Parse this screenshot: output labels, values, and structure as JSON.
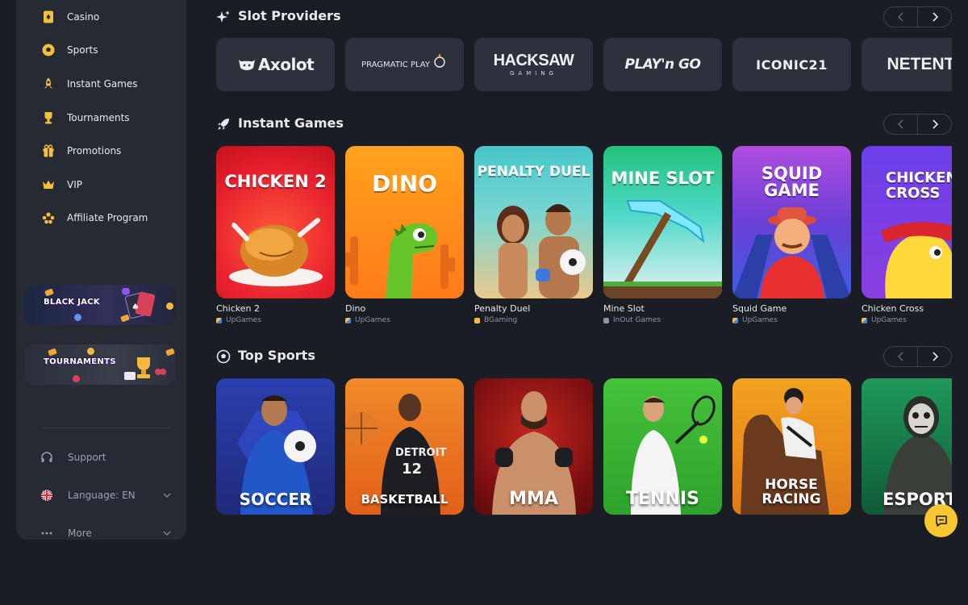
{
  "sidebar": {
    "items": [
      {
        "label": "Casino",
        "icon": "cards-icon"
      },
      {
        "label": "Sports",
        "icon": "soccer-ball-icon"
      },
      {
        "label": "Instant Games",
        "icon": "rocket-icon"
      },
      {
        "label": "Tournaments",
        "icon": "trophy-icon"
      },
      {
        "label": "Promotions",
        "icon": "gift-icon"
      },
      {
        "label": "VIP",
        "icon": "crown-icon"
      },
      {
        "label": "Affiliate Program",
        "icon": "group-icon"
      }
    ],
    "banners": {
      "blackjack": "BLACK JACK",
      "tournaments": "TOURNAMENTS"
    },
    "footer": {
      "support": "Support",
      "language": "Language: EN",
      "more": "More"
    }
  },
  "sections": {
    "slot_providers": {
      "title": "Slot Providers",
      "providers": [
        "Axolot",
        "PRAGMATIC PLAY",
        "HACKSAW",
        "GAMING",
        "PLAY'n GO",
        "ICONIC21",
        "NETENT"
      ]
    },
    "instant_games": {
      "title": "Instant Games",
      "games": [
        {
          "thumb_title": "CHICKEN 2",
          "name": "Chicken 2",
          "provider": "UpGames"
        },
        {
          "thumb_title": "DINO",
          "name": "Dino",
          "provider": "UpGames"
        },
        {
          "thumb_title": "PENALTY DUEL",
          "name": "Penalty Duel",
          "provider": "BGaming"
        },
        {
          "thumb_title": "MINE SLOT",
          "name": "Mine Slot",
          "provider": "InOut Games"
        },
        {
          "thumb_title": "SQUID GAME",
          "name": "Squid Game",
          "provider": "UpGames"
        },
        {
          "thumb_title": "CHICKEN CROSS",
          "name": "Chicken Cross",
          "provider": "UpGames"
        }
      ]
    },
    "top_sports": {
      "title": "Top Sports",
      "sports": [
        "SOCCER",
        "BASKETBALL",
        "MMA",
        "TENNIS",
        "HORSE RACING",
        "ESPORT"
      ]
    }
  },
  "colors": {
    "background": "#1a1d24",
    "sidebar": "#262a33",
    "card": "#2c313c",
    "accent_yellow": "#f7c631"
  }
}
